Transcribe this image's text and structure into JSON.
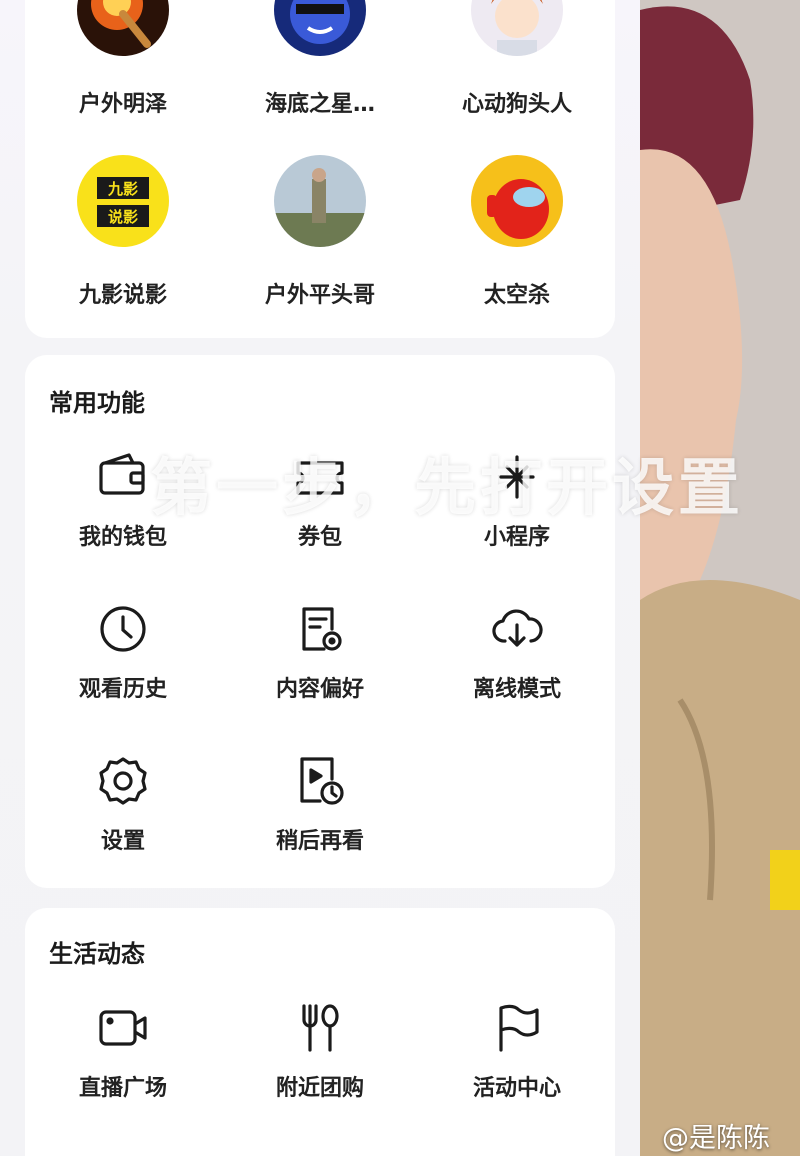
{
  "follow": {
    "items": [
      {
        "name": "户外明泽",
        "avatar_icon": "match-flame-avatar"
      },
      {
        "name": "海底之星…",
        "avatar_icon": "cool-face-avatar"
      },
      {
        "name": "心动狗头人",
        "avatar_icon": "anime-boy-avatar"
      },
      {
        "name": "九影说影",
        "avatar_icon": "jiuying-logo-avatar"
      },
      {
        "name": "户外平头哥",
        "avatar_icon": "outdoor-man-avatar"
      },
      {
        "name": "太空杀",
        "avatar_icon": "space-crewmate-avatar"
      }
    ]
  },
  "common": {
    "title": "常用功能",
    "items": [
      {
        "label": "我的钱包",
        "icon": "wallet-icon"
      },
      {
        "label": "券包",
        "icon": "coupon-icon"
      },
      {
        "label": "小程序",
        "icon": "mini-program-icon"
      },
      {
        "label": "观看历史",
        "icon": "clock-icon"
      },
      {
        "label": "内容偏好",
        "icon": "preference-doc-icon"
      },
      {
        "label": "离线模式",
        "icon": "cloud-download-icon"
      },
      {
        "label": "设置",
        "icon": "gear-icon"
      },
      {
        "label": "稍后再看",
        "icon": "watch-later-icon"
      }
    ]
  },
  "life": {
    "title": "生活动态",
    "items": [
      {
        "label": "直播广场",
        "icon": "camera-icon"
      },
      {
        "label": "附近团购",
        "icon": "fork-spoon-icon"
      },
      {
        "label": "活动中心",
        "icon": "flag-icon"
      }
    ]
  },
  "video": {
    "caption": "第一步，先打开设置",
    "watermark": "@是陈陈"
  }
}
